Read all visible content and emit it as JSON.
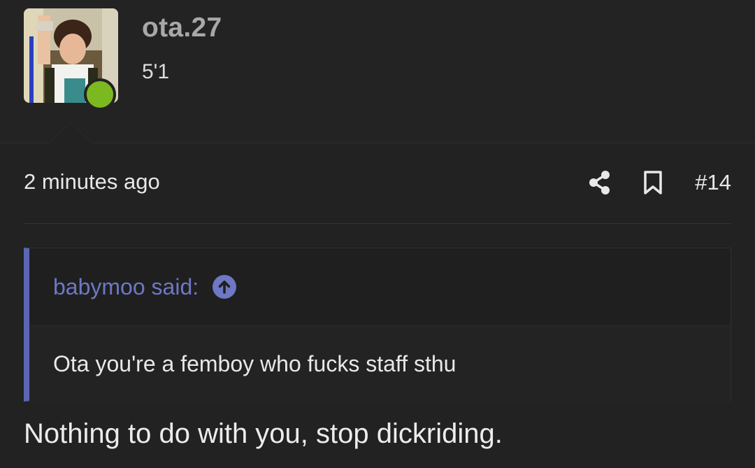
{
  "user": {
    "username": "ota.27",
    "title": "5'1",
    "status_color": "#7cb81f"
  },
  "post": {
    "time": "2 minutes ago",
    "number": "#14",
    "body": "Nothing to do with you, stop dickriding."
  },
  "actions": {
    "share_icon": "share-icon",
    "bookmark_icon": "bookmark-icon"
  },
  "quote": {
    "author_line": "babymoo said:",
    "text": "Ota you're a femboy who fucks staff sthu",
    "accent_color": "#5b66b4"
  }
}
